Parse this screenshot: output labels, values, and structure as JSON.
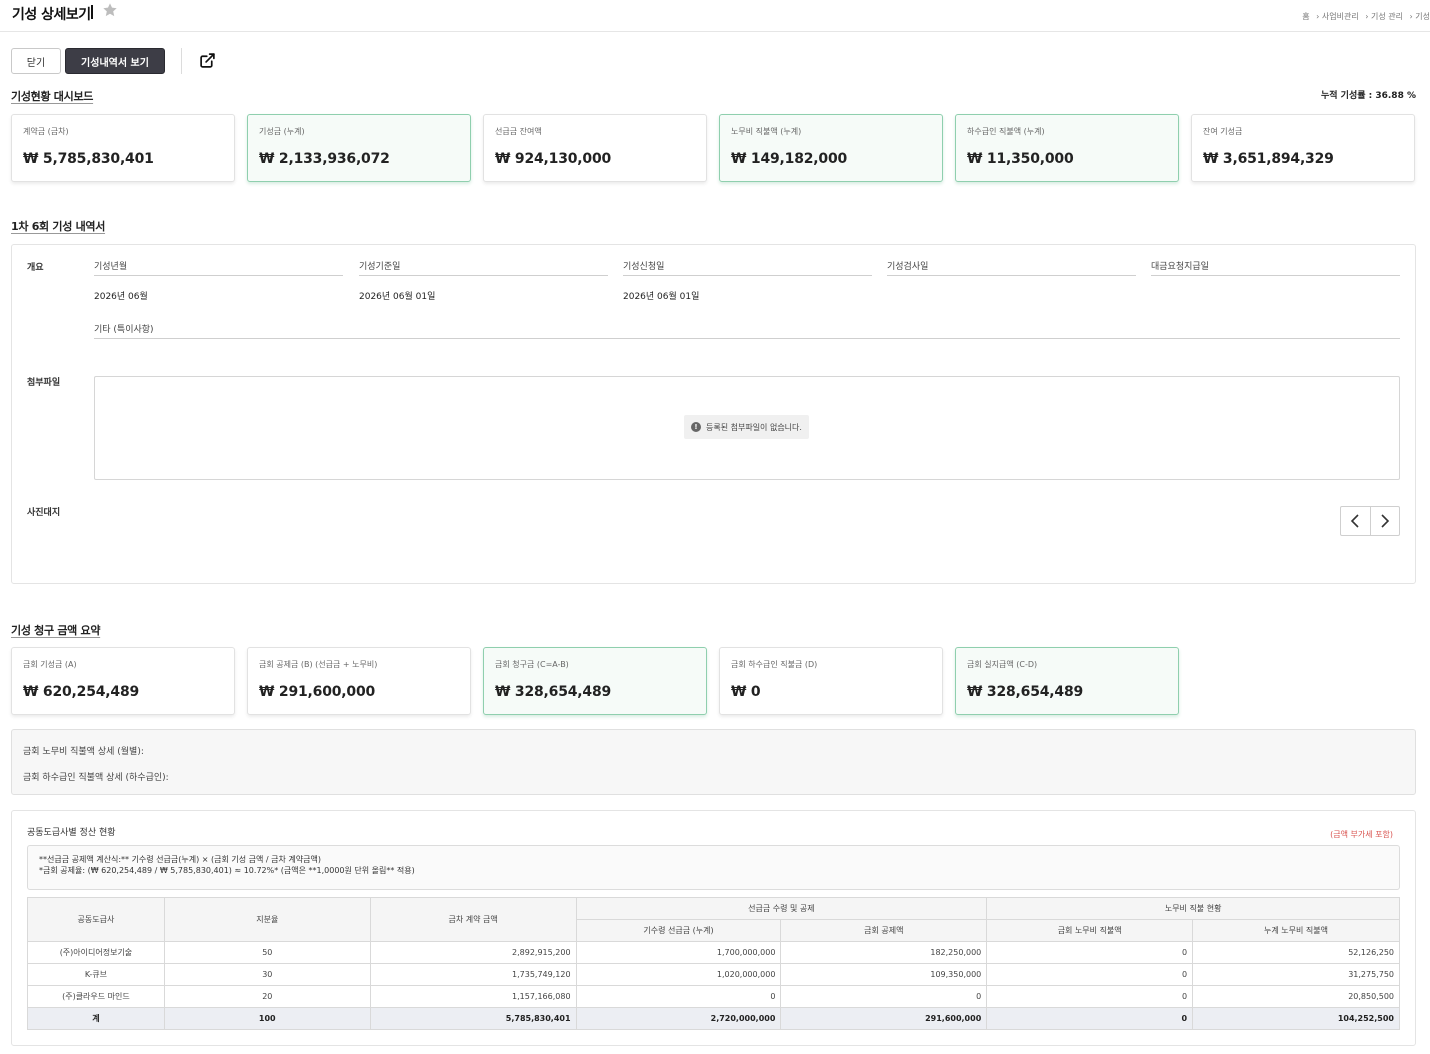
{
  "header": {
    "title": "기성 상세보기",
    "breadcrumb": [
      "홈",
      "› 사업비관리",
      "› 기성 관리",
      "› 기성"
    ]
  },
  "toolbar": {
    "close_label": "닫기",
    "view_statement_label": "기성내역서 보기"
  },
  "dashboard": {
    "title": "기성현황 대시보드",
    "cumulative_rate": "누적 기성률 : 36.88 %",
    "cards": [
      {
        "label": "계약금 (금차)",
        "value": "₩ 5,785,830,401"
      },
      {
        "label": "기성금 (누계)",
        "value": "₩ 2,133,936,072"
      },
      {
        "label": "선급금 잔여액",
        "value": "₩ 924,130,000"
      },
      {
        "label": "노무비 직불액 (누계)",
        "value": "₩ 149,182,000"
      },
      {
        "label": "하수급인 직불액 (누계)",
        "value": "₩ 11,350,000"
      },
      {
        "label": "잔여 기성금",
        "value": "₩ 3,651,894,329"
      }
    ]
  },
  "statement": {
    "title": "1차 6회 기성 내역서",
    "overview_label": "개요",
    "fields": [
      {
        "label": "기성년월",
        "value": "2026년 06월"
      },
      {
        "label": "기성기준일",
        "value": "2026년 06월 01일"
      },
      {
        "label": "기성신청일",
        "value": "2026년 06월 01일"
      },
      {
        "label": "기성검사일",
        "value": ""
      },
      {
        "label": "대금요청지급일",
        "value": ""
      }
    ],
    "remarks_label": "기타 (특이사항)",
    "attachment_label": "첨부파일",
    "attachment_empty": "등록된 첨부파일이 없습니다.",
    "photo_label": "사진대지"
  },
  "summary": {
    "title": "기성 청구 금액 요약",
    "cards": [
      {
        "label": "금회 기성금 (A)",
        "value": "₩ 620,254,489"
      },
      {
        "label": "금회 공제금 (B) (선급금 + 노무비)",
        "value": "₩ 291,600,000"
      },
      {
        "label": "금회 청구금 (C=A-B)",
        "value": "₩ 328,654,489"
      },
      {
        "label": "금회 하수급인 직불금 (D)",
        "value": "₩ 0"
      },
      {
        "label": "금회 실지급액 (C-D)",
        "value": "₩ 328,654,489"
      }
    ],
    "labor_detail": "금회 노무비 직불액 상세 (월별):",
    "subcontract_detail": "금회 하수급인 직불액 상세 (하수급인):"
  },
  "settlement": {
    "title": "공동도급사별 정산 현황",
    "vat_note": "(금액 부가세 포함)",
    "formula_line1": "**선급금 공제액 계산식:** 기수령 선급금(누계) × (금회 기성 금액 / 금차 계약금액)",
    "formula_line2": "*금회 공제율: (₩ 620,254,489 / ₩ 5,785,830,401) ≈ 10.72%* (금액은 **1,0000원 단위 올림** 적용)",
    "headers": {
      "company": "공동도급사",
      "share": "지분율",
      "contract": "금차 계약 금액",
      "advance_group": "선급금 수령 및 공제",
      "labor_group": "노무비 직불 현황",
      "advance_received": "기수령 선급금 (누계)",
      "deduction": "금회 공제액",
      "labor_current": "금회 노무비 직불액",
      "labor_cumulative": "누계 노무비 직불액"
    },
    "rows": [
      {
        "company": "(주)아이디어정보기술",
        "share": "50",
        "contract": "2,892,915,200",
        "advance": "1,700,000,000",
        "deduction": "182,250,000",
        "labor_current": "0",
        "labor_cumulative": "52,126,250"
      },
      {
        "company": "K-큐브",
        "share": "30",
        "contract": "1,735,749,120",
        "advance": "1,020,000,000",
        "deduction": "109,350,000",
        "labor_current": "0",
        "labor_cumulative": "31,275,750"
      },
      {
        "company": "(주)클라우드 마인드",
        "share": "20",
        "contract": "1,157,166,080",
        "advance": "0",
        "deduction": "0",
        "labor_current": "0",
        "labor_cumulative": "20,850,500"
      }
    ],
    "total": {
      "company": "계",
      "share": "100",
      "contract": "5,785,830,401",
      "advance": "2,720,000,000",
      "deduction": "291,600,000",
      "labor_current": "0",
      "labor_cumulative": "104,252,500"
    }
  }
}
